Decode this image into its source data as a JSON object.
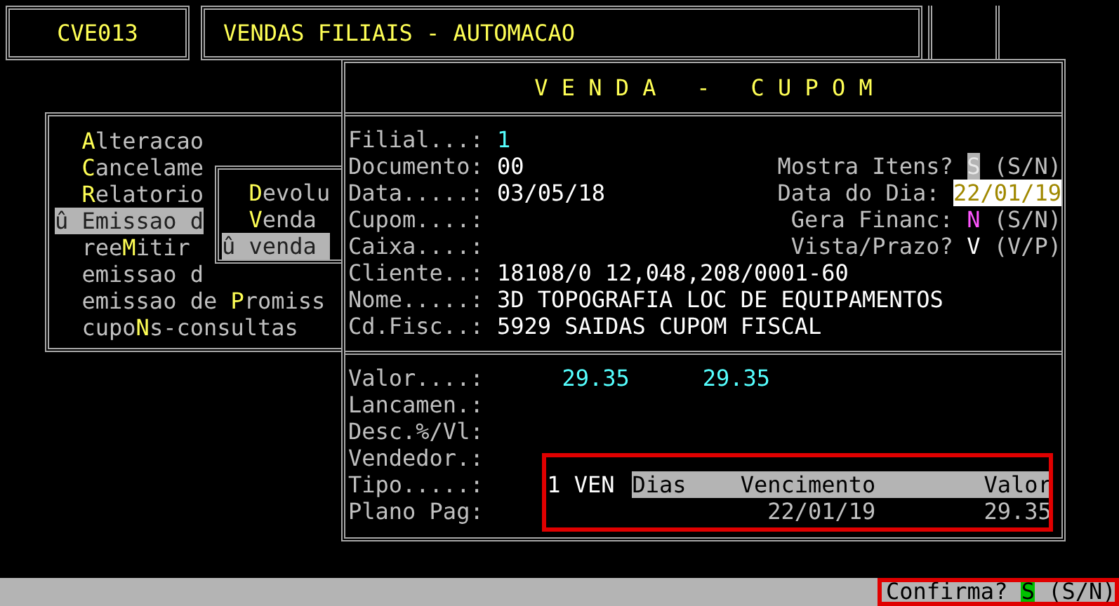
{
  "header": {
    "code": "CVE013",
    "title": "VENDAS FILIAIS - AUTOMACAO"
  },
  "menu": {
    "items": [
      {
        "hot": "A",
        "post": "lteracao",
        "selected": false
      },
      {
        "hot": "C",
        "post": "ancelame",
        "selected": false
      },
      {
        "hot": "R",
        "post": "elatorio",
        "selected": false
      },
      {
        "marker": "û",
        "post": "Emissao d",
        "selected": true
      },
      {
        "pre": "ree",
        "hot": "M",
        "post": "itir",
        "selected": false
      },
      {
        "post": "emissao d",
        "selected": false
      },
      {
        "pre": "emissao de ",
        "hot": "P",
        "post": "romiss",
        "selected": false
      },
      {
        "pre": "cupo",
        "hot": "N",
        "post": "s-consultas",
        "selected": false
      }
    ]
  },
  "submenu": {
    "items": [
      {
        "hot": "D",
        "post": "evolu",
        "selected": false
      },
      {
        "hot": "V",
        "post": "enda",
        "selected": false
      },
      {
        "marker": "û",
        "post": "venda",
        "selected": true
      }
    ]
  },
  "venda": {
    "title": "V E N D A   -   C U P O M",
    "fields": [
      {
        "label": "Filial...:",
        "value": "1",
        "color": "#55ffff"
      },
      {
        "label": "Documento:",
        "value": "00",
        "color": "#ffffff"
      },
      {
        "label": "Data.....:",
        "value": "03/05/18",
        "color": "#ffffff"
      },
      {
        "label": "Cupom....:"
      },
      {
        "label": "Caixa....:"
      },
      {
        "label": "Cliente..:",
        "value": "18108/0 12,048,208/0001-60",
        "color": "#ffffff"
      },
      {
        "label": "Nome.....:",
        "value": "3D TOPOGRAFIA LOC DE EQUIPAMENTOS",
        "color": "#ffffff"
      },
      {
        "label": "Cd.Fisc..:",
        "value": "5929 SAIDAS CUPOM FISCAL",
        "color": "#ffffff"
      }
    ],
    "options": [
      {
        "label": "Mostra Itens?",
        "value": "S",
        "options": "(S/N)",
        "kind": "inverse"
      },
      {
        "label": "Data do Dia:",
        "value": "22/01/19",
        "kind": "input",
        "color": "#a08800"
      },
      {
        "label": "Gera Financ:",
        "value": "N",
        "options": "(S/N)",
        "kind": "plain",
        "color": "#ff55ff"
      },
      {
        "label": "Vista/Prazo?",
        "value": "V",
        "options": "(V/P)",
        "kind": "plain",
        "color": "#ffffff"
      }
    ],
    "totals": [
      {
        "label": "Valor....:",
        "values": [
          "29.35",
          "29.35"
        ]
      },
      {
        "label": "Lancamen.:"
      },
      {
        "label": "Desc.%/Vl:"
      },
      {
        "label": "Vendedor.:"
      },
      {
        "label": "Tipo.....:",
        "value": "1 VEN"
      },
      {
        "label": "Plano Pag:"
      }
    ],
    "installments": {
      "columns": [
        "Dias",
        "Vencimento",
        "Valor"
      ],
      "rows": [
        {
          "vencimento": "22/01/19",
          "valor": "29.35"
        }
      ]
    }
  },
  "status_bar": {
    "prompt": "Confirma?",
    "answer": "S",
    "options": "(S/N)"
  }
}
